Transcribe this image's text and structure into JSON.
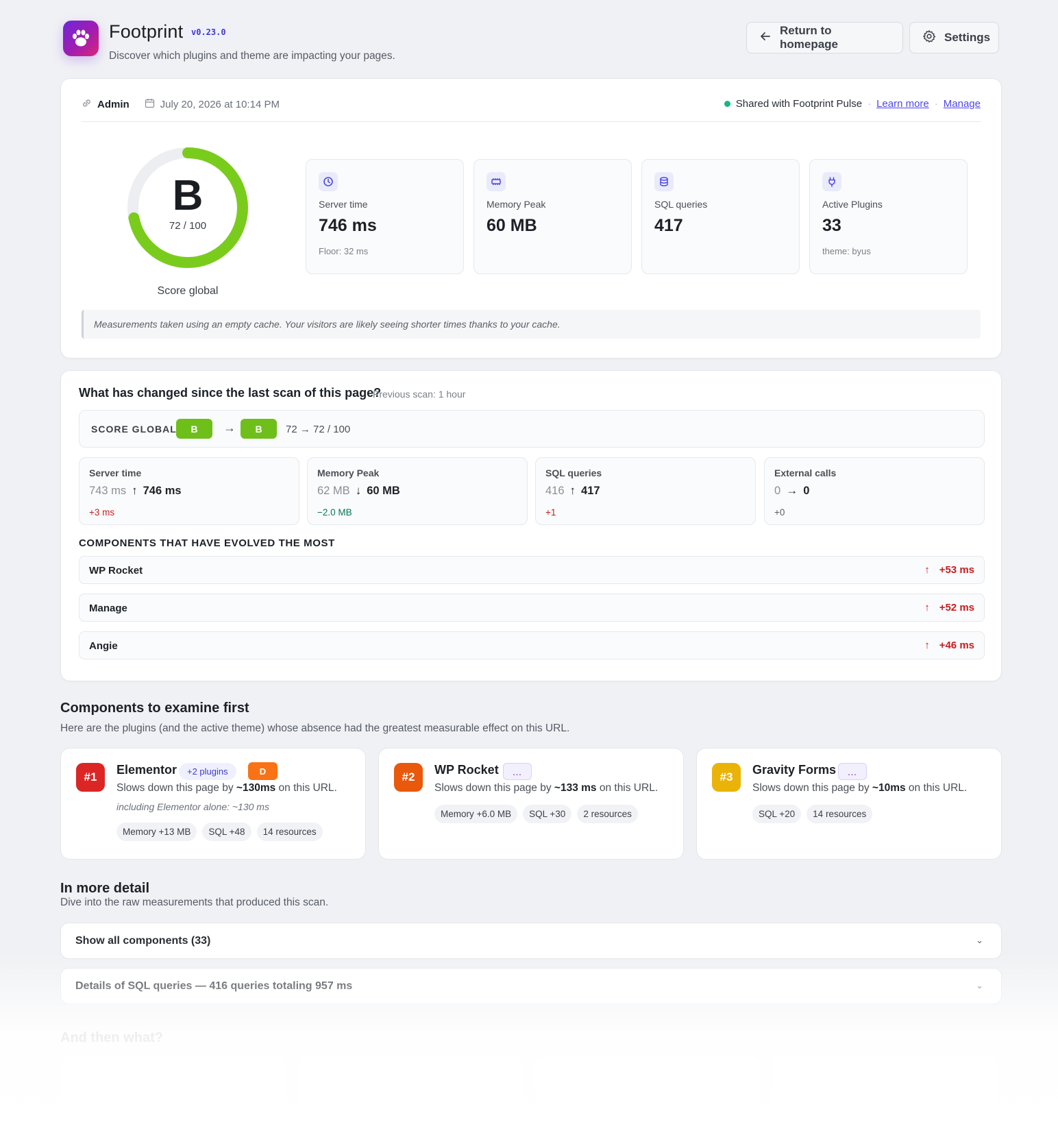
{
  "header": {
    "app_title": "Footprint",
    "version": "v0.23.0",
    "subtitle": "Discover which plugins and theme are impacting your pages.",
    "return_label": "Return to homepage",
    "settings_label": "Settings"
  },
  "scan": {
    "user": "Admin",
    "date": "July 20, 2026 at 10:14 PM",
    "shared_text": "Shared with Footprint Pulse",
    "learn_more": "Learn more",
    "manage": "Manage",
    "score_letter": "B",
    "score_value": "72 / 100",
    "score_fraction": 0.72,
    "score_label": "Score global",
    "stats": [
      {
        "label": "Server time",
        "value": "746 ms",
        "sub": "Floor: 32 ms",
        "icon": "clock-icon"
      },
      {
        "label": "Memory Peak",
        "value": "60 MB",
        "sub": "",
        "icon": "memory-chip-icon"
      },
      {
        "label": "SQL queries",
        "value": "417",
        "sub": "",
        "icon": "database-icon"
      },
      {
        "label": "Active Plugins",
        "value": "33",
        "sub": "theme: byus",
        "icon": "plug-icon"
      }
    ],
    "note": "Measurements taken using an empty cache. Your visitors are likely seeing shorter times thanks to your cache."
  },
  "changes": {
    "title": "What has changed since the last scan of this page?",
    "previous": "Previous scan: 1 hour",
    "score_label": "SCORE GLOBAL",
    "grade_from": "B",
    "grade_to": "B",
    "score_range": "72 → 72 / 100",
    "deltas": [
      {
        "label": "Server time",
        "old": "743 ms",
        "arrow": "↑",
        "new": "746 ms",
        "change": "+3 ms",
        "tone": "red"
      },
      {
        "label": "Memory Peak",
        "old": "62 MB",
        "arrow": "↓",
        "new": "60 MB",
        "change": "−2.0 MB",
        "tone": "green"
      },
      {
        "label": "SQL queries",
        "old": "416",
        "arrow": "↑",
        "new": "417",
        "change": "+1",
        "tone": "red"
      },
      {
        "label": "External calls",
        "old": "0",
        "arrow": "→",
        "new": "0",
        "change": "+0",
        "tone": "grey"
      }
    ],
    "evolved_title": "COMPONENTS THAT HAVE EVOLVED THE MOST",
    "evolved": [
      {
        "name": "WP Rocket",
        "delta": "+53 ms"
      },
      {
        "name": "Manage",
        "delta": "+52 ms"
      },
      {
        "name": "Angie",
        "delta": "+46 ms"
      }
    ]
  },
  "components": {
    "title": "Components to examine first",
    "subtitle": "Here are the plugins (and the active theme) whose absence had the greatest measurable effect on this URL.",
    "items": [
      {
        "rank": "#1",
        "rank_color": "#dc2626",
        "name": "Elementor",
        "badge": "+2 plugins",
        "grade": "D",
        "desc_pre": "Slows down this page by ",
        "desc_bold": "~130ms",
        "desc_post": " on this URL.",
        "including": "including Elementor alone: ~130 ms",
        "tags": [
          "Memory +13 MB",
          "SQL +48",
          "14 resources"
        ]
      },
      {
        "rank": "#2",
        "rank_color": "#ea580c",
        "name": "WP Rocket",
        "badge": "…",
        "desc_pre": "Slows down this page by ",
        "desc_bold": "~133 ms",
        "desc_post": " on this URL.",
        "tags": [
          "Memory +6.0 MB",
          "SQL +30",
          "2 resources"
        ]
      },
      {
        "rank": "#3",
        "rank_color": "#eab308",
        "name": "Gravity Forms",
        "badge": "…",
        "desc_pre": "Slows down this page by ",
        "desc_bold": "~10ms",
        "desc_post": " on this URL.",
        "tags": [
          "SQL +20",
          "14 resources"
        ]
      }
    ]
  },
  "detail": {
    "title": "In more detail",
    "subtitle": "Dive into the raw measurements that produced this scan.",
    "accordions": [
      "Show all components (33)",
      "Details of SQL queries — 416 queries totaling 957 ms"
    ]
  },
  "next": {
    "title": "And then what?"
  }
}
